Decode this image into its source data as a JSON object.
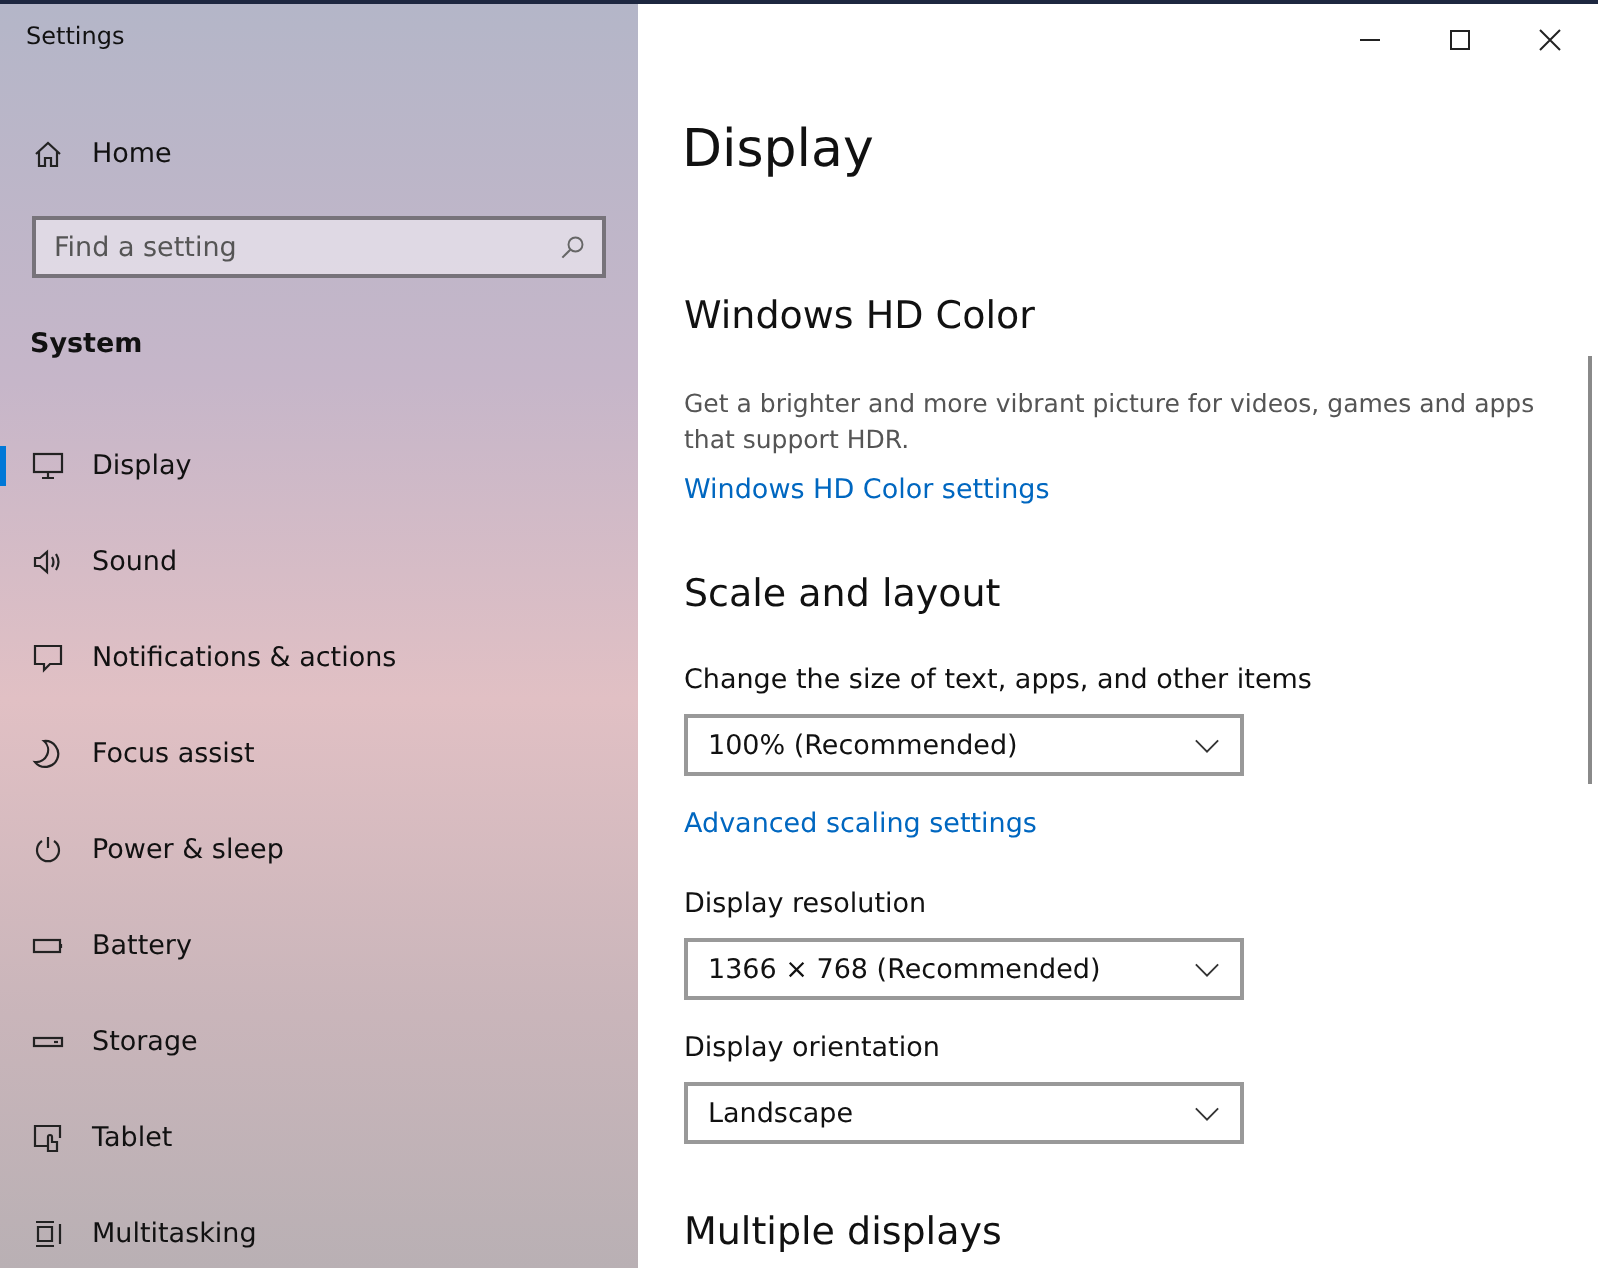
{
  "window": {
    "title": "Settings"
  },
  "sidebar": {
    "home": "Home",
    "search": {
      "placeholder": "Find a setting"
    },
    "section": "System",
    "items": [
      {
        "label": "Display",
        "kind": "display",
        "selected": true
      },
      {
        "label": "Sound",
        "kind": "sound",
        "selected": false
      },
      {
        "label": "Notifications & actions",
        "kind": "notifications",
        "selected": false
      },
      {
        "label": "Focus assist",
        "kind": "focus",
        "selected": false
      },
      {
        "label": "Power & sleep",
        "kind": "power",
        "selected": false
      },
      {
        "label": "Battery",
        "kind": "battery",
        "selected": false
      },
      {
        "label": "Storage",
        "kind": "storage",
        "selected": false
      },
      {
        "label": "Tablet",
        "kind": "tablet",
        "selected": false
      },
      {
        "label": "Multitasking",
        "kind": "multitasking",
        "selected": false
      }
    ]
  },
  "page": {
    "title": "Display",
    "blocks": [
      {
        "kind": "heading",
        "text": "Windows HD Color"
      },
      {
        "kind": "text",
        "text": "Get a brighter and more vibrant picture for videos, games and apps that support HDR."
      },
      {
        "kind": "link",
        "text": "Windows HD Color settings"
      },
      {
        "kind": "heading",
        "text": "Scale and layout"
      },
      {
        "kind": "label",
        "text": "Change the size of text, apps, and other items"
      },
      {
        "kind": "dropdown",
        "text": "100% (Recommended)"
      },
      {
        "kind": "link",
        "text": "Advanced scaling settings"
      },
      {
        "kind": "label",
        "text": "Display resolution"
      },
      {
        "kind": "dropdown",
        "text": "1366 × 768 (Recommended)"
      },
      {
        "kind": "label",
        "text": "Display orientation"
      },
      {
        "kind": "dropdown",
        "text": "Landscape"
      },
      {
        "kind": "heading",
        "text": "Multiple displays"
      }
    ]
  }
}
